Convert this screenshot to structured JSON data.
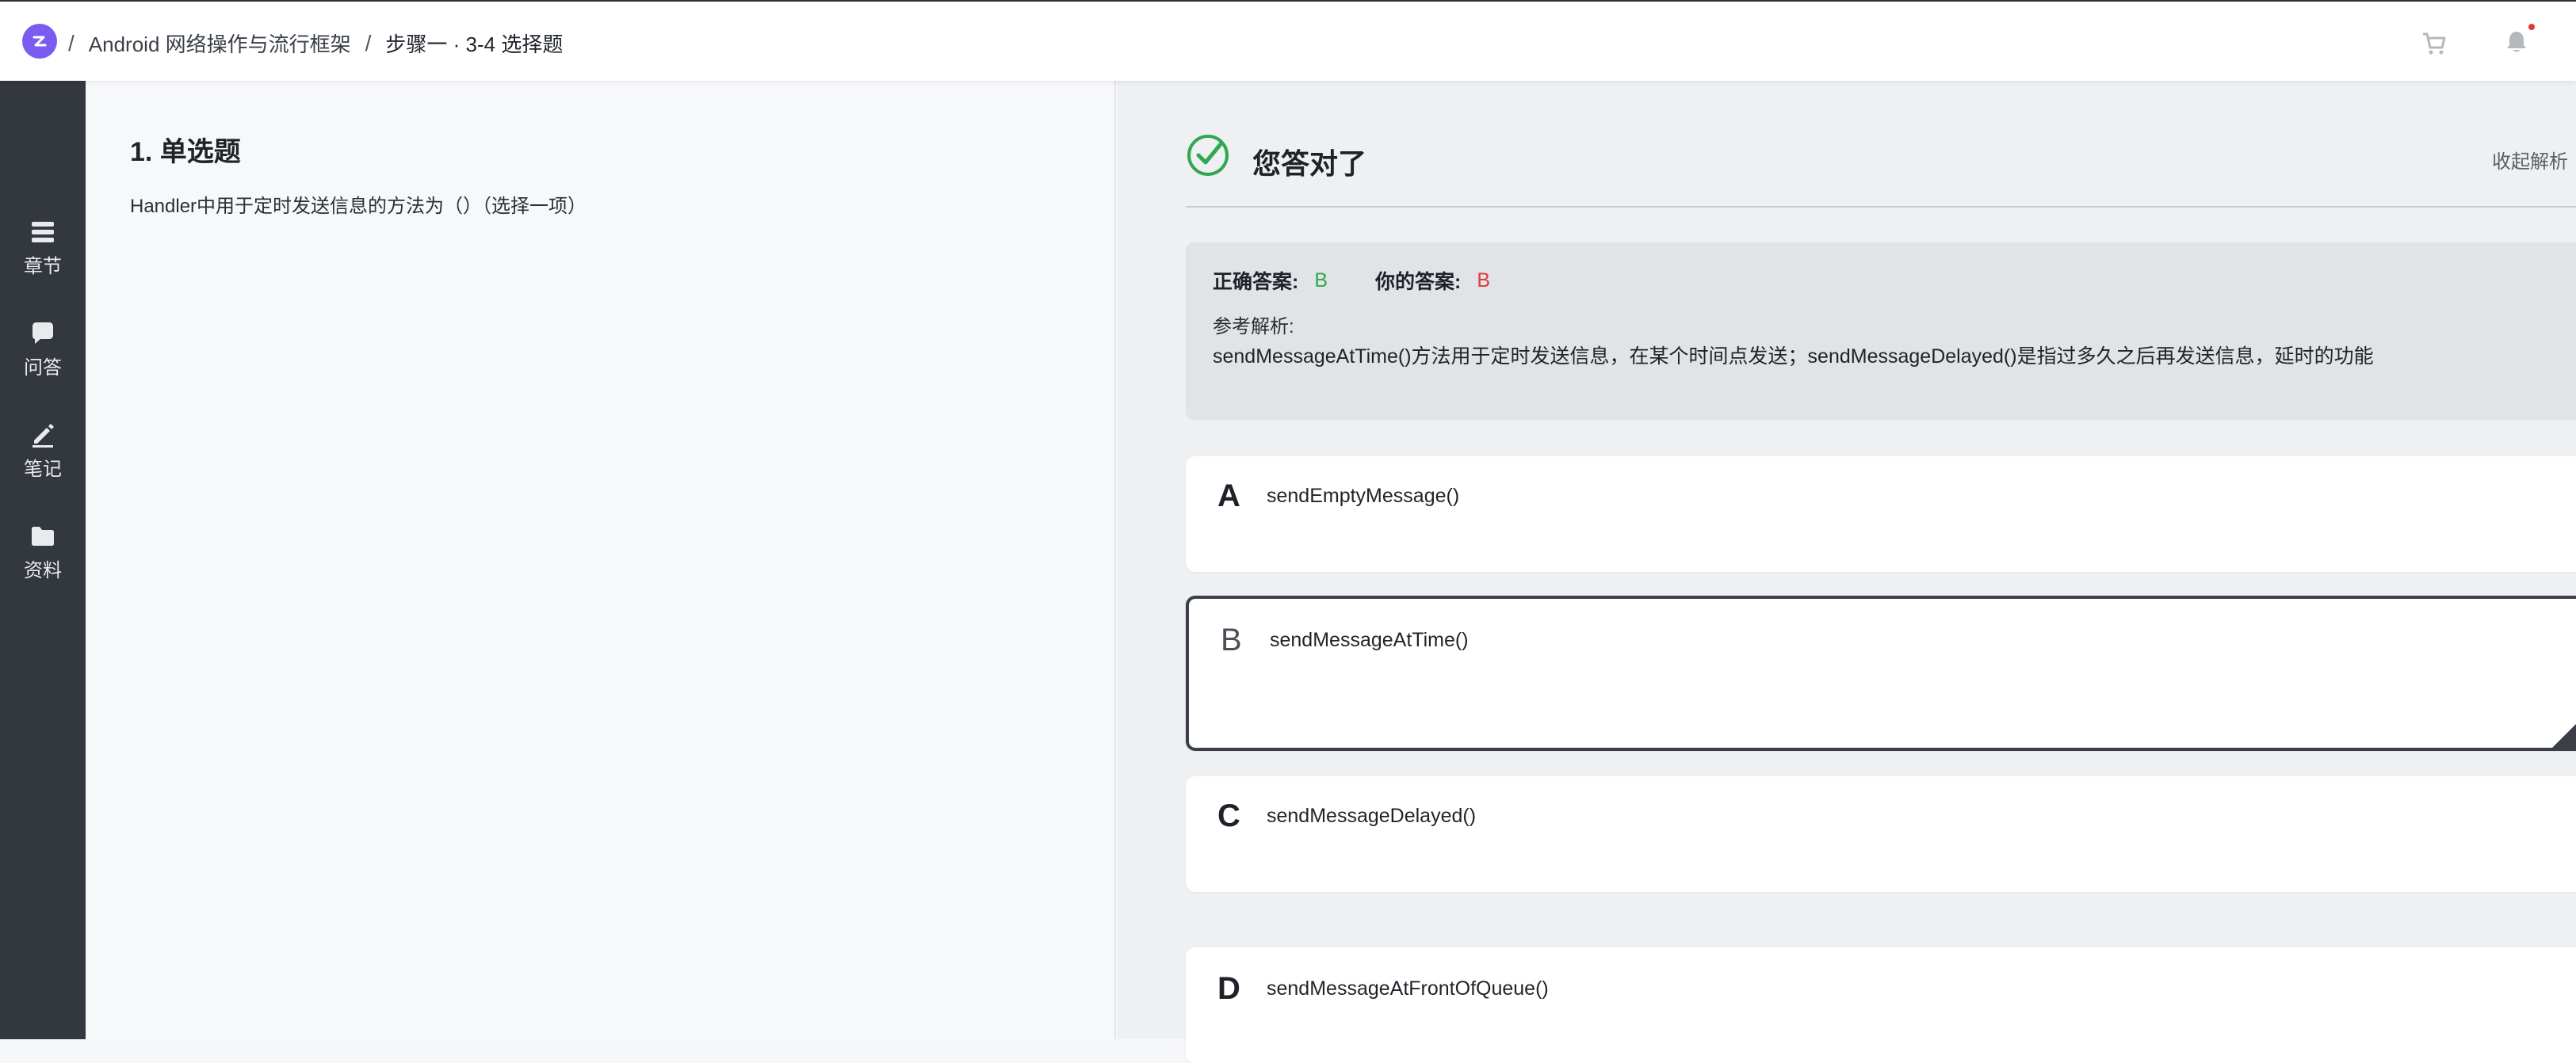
{
  "header": {
    "separator": "/",
    "course_title": "Android 网络操作与流行框架",
    "step_title": "步骤一 · 3-4 选择题",
    "icons": [
      "logo-icon",
      "cart-icon",
      "bell-icon"
    ],
    "notification_dot_color": "#e03a3a",
    "logo_color": "#7b5cf0"
  },
  "sidebar": {
    "items": [
      {
        "label": "章节",
        "icon": "chapters-icon"
      },
      {
        "label": "问答",
        "icon": "qa-icon"
      },
      {
        "label": "笔记",
        "icon": "note-icon"
      },
      {
        "label": "资料",
        "icon": "folder-icon"
      }
    ]
  },
  "question": {
    "title": "1. 单选题",
    "text": "Handler中用于定时发送信息的方法为（）（选择一项）"
  },
  "result": {
    "status_text": "您答对了",
    "collapse_label": "收起解析",
    "status_color": "#2fa84f"
  },
  "explanation": {
    "correct_label": "正确答案:",
    "correct_value": "B",
    "yours_label": "你的答案:",
    "yours_value": "B",
    "analysis_label": "参考解析:",
    "analysis_text": "sendMessageAtTime()方法用于定时发送信息，在某个时间点发送；sendMessageDelayed()是指过多久之后再发送信息，延时的功能"
  },
  "options": [
    {
      "letter": "A",
      "text": "sendEmptyMessage()",
      "selected": false
    },
    {
      "letter": "B",
      "text": "sendMessageAtTime()",
      "selected": true
    },
    {
      "letter": "C",
      "text": "sendMessageDelayed()",
      "selected": false
    },
    {
      "letter": "D",
      "text": "sendMessageAtFrontOfQueue()",
      "selected": false
    }
  ]
}
